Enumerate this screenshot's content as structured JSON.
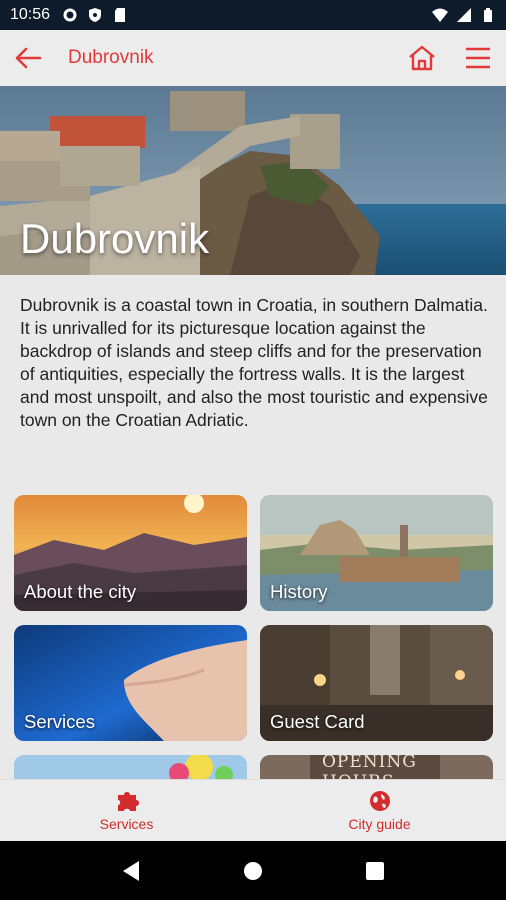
{
  "status_bar": {
    "time": "10:56"
  },
  "app_bar": {
    "title": "Dubrovnik"
  },
  "hero": {
    "title": "Dubrovnik"
  },
  "description": "Dubrovnik is a coastal town in Croatia, in southern Dalmatia. It is unrivalled for its picturesque location against the backdrop of islands and steep cliffs and for the preservation of antiquities, especially the fortress walls. It is the largest and most unspoilt, and also the most touristic and expensive town on the Croatian Adriatic.",
  "tiles": [
    {
      "label": "About the city"
    },
    {
      "label": "History"
    },
    {
      "label": "Services"
    },
    {
      "label": "Guest Card"
    },
    {
      "label": ""
    },
    {
      "label": "OPENING HOURS"
    }
  ],
  "bottom_nav": {
    "items": [
      {
        "label": "Services",
        "icon": "puzzle-icon"
      },
      {
        "label": "City guide",
        "icon": "globe-icon"
      }
    ]
  },
  "colors": {
    "accent": "#e23a3a",
    "status_bar": "#0d1b2a"
  }
}
